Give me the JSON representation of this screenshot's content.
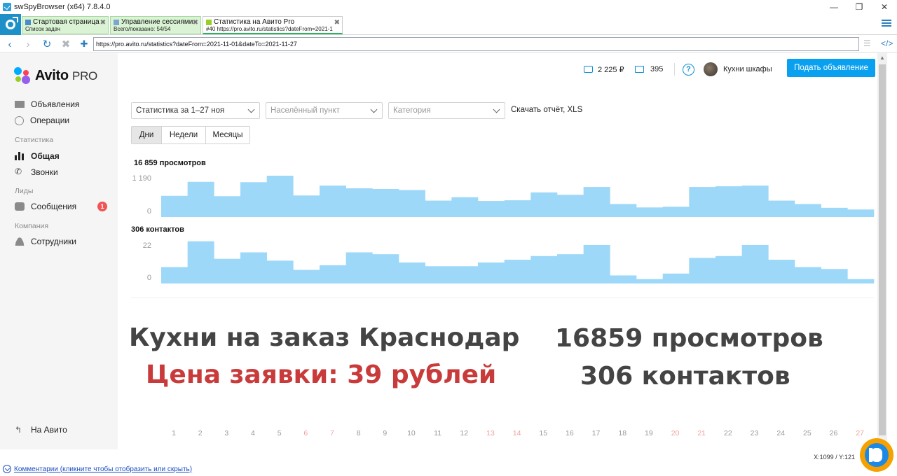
{
  "window": {
    "title": "swSpyBrowser (x64) 7.8.4.0",
    "minimize": "—",
    "maximize": "❐",
    "close": "✕"
  },
  "tabs": [
    {
      "title": "Стартовая страница",
      "subtitle": "Список задач"
    },
    {
      "title": "Управление сессиями",
      "subtitle": "Всего/показано: 54/54"
    },
    {
      "title": "Статистика на Авито Pro",
      "subtitle": "#40 https://pro.avito.ru/statistics?dateFrom=2021-1"
    }
  ],
  "nav": {
    "url": "https://pro.avito.ru/statistics?dateFrom=2021-11-01&dateTo=2021-11-27"
  },
  "sidebar": {
    "brand": "Avito",
    "brand_suffix": "PRO",
    "items": {
      "ads": "Объявления",
      "operations": "Операции",
      "stats_heading": "Статистика",
      "general": "Общая",
      "calls": "Звонки",
      "leads_heading": "Лиды",
      "messages": "Сообщения",
      "messages_badge": "1",
      "company_heading": "Компания",
      "employees": "Сотрудники",
      "back": "На Авито"
    }
  },
  "header": {
    "balance": "2 225 ₽",
    "bonus": "395",
    "help": "?",
    "profile_name": "Кухни шкафы",
    "post_button": "Подать объявление"
  },
  "filters": {
    "period": "Статистика за 1–27 ноя",
    "city_placeholder": "Населённый пункт",
    "category_placeholder": "Категория",
    "download": "Скачать отчёт, XLS"
  },
  "granularity": {
    "days": "Дни",
    "weeks": "Недели",
    "months": "Месяцы",
    "selected": "Дни"
  },
  "overlay": {
    "left_title": "Кухни на заказ Краснодар",
    "left_price": "Цена заявки: 39 рублей",
    "right_views": "16859 просмотров",
    "right_contacts": "306 контактов"
  },
  "status": {
    "coords": "X:1099 / Y:121",
    "comments": "Комментарии (кликните чтобы отобразить или скрыть)"
  },
  "colors": {
    "bar": "#9ed8f8",
    "accent": "#0aa0f0",
    "weekend": "#f0a0a0",
    "overlay_dark": "#444444",
    "overlay_red": "#c93b3b"
  },
  "chart_data": [
    {
      "type": "bar",
      "title": "16 859 просмотров",
      "categories": [
        "1",
        "2",
        "3",
        "4",
        "5",
        "6",
        "7",
        "8",
        "9",
        "10",
        "11",
        "12",
        "13",
        "14",
        "15",
        "16",
        "17",
        "18",
        "19",
        "20",
        "21",
        "22",
        "23",
        "24",
        "25",
        "26",
        "27"
      ],
      "weekend": [
        "6",
        "7",
        "13",
        "14",
        "20",
        "21",
        "27"
      ],
      "values": [
        600,
        1010,
        590,
        1000,
        1190,
        610,
        900,
        820,
        800,
        770,
        460,
        560,
        450,
        470,
        700,
        630,
        860,
        360,
        260,
        280,
        860,
        880,
        900,
        460,
        360,
        250,
        200
      ],
      "ylim": [
        0,
        1190
      ],
      "yticks": [
        "1 190",
        "0"
      ]
    },
    {
      "type": "bar",
      "title": "306 контактов",
      "categories": [
        "1",
        "2",
        "3",
        "4",
        "5",
        "6",
        "7",
        "8",
        "9",
        "10",
        "11",
        "12",
        "13",
        "14",
        "15",
        "16",
        "17",
        "18",
        "19",
        "20",
        "21",
        "22",
        "23",
        "24",
        "25",
        "26",
        "27"
      ],
      "values": [
        8.5,
        22.5,
        13.0,
        16.5,
        12.0,
        7.0,
        9.5,
        16.5,
        15.5,
        11.0,
        9.0,
        9.0,
        11.0,
        12.5,
        14.5,
        15.5,
        20.5,
        4.0,
        2.0,
        5.0,
        13.5,
        14.5,
        20.5,
        12.5,
        8.5,
        7.5,
        2.0
      ],
      "ylim": [
        0,
        22
      ],
      "yticks": [
        "22",
        "0"
      ]
    }
  ]
}
